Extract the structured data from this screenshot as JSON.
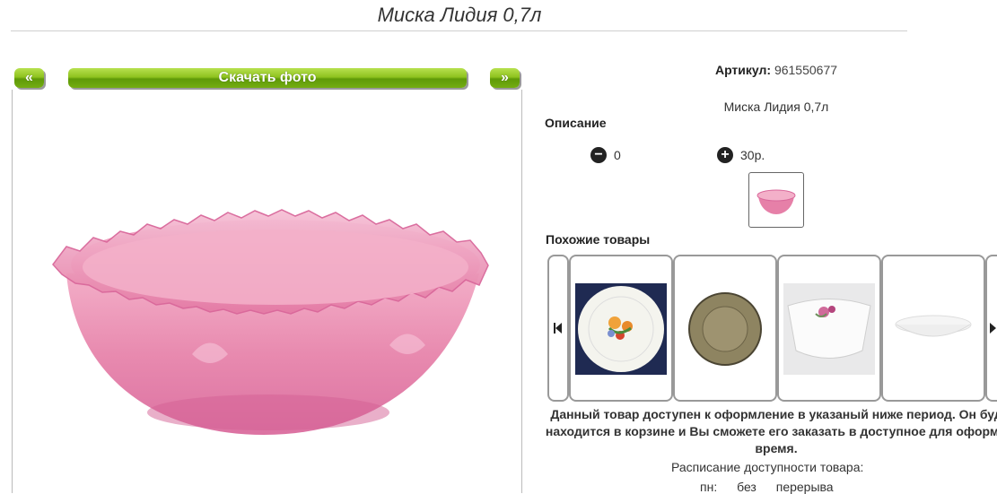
{
  "page": {
    "title": "Миска Лидия 0,7л"
  },
  "gallery": {
    "prev_label": "«",
    "download_label": "Скачать фото",
    "next_label": "»"
  },
  "product": {
    "sku_label": "Артикул:",
    "sku_value": "961550677",
    "name": "Миска Лидия 0,7л",
    "description_heading": "Описание",
    "qty_minus_value": "0",
    "qty_plus_value": "30р."
  },
  "similar": {
    "heading": "Похожие товары",
    "items": [
      {
        "image": "plate-with-flowers"
      },
      {
        "image": "amber-glass-plate"
      },
      {
        "image": "white-square-bowl-with-rose"
      },
      {
        "image": "white-shallow-dish"
      }
    ]
  },
  "availability": {
    "line1": "Данный товар доступен к оформление в указаный ниже период. Он буд",
    "line2": "находится в корзине и Вы сможете его заказать в доступное для оформл",
    "line3": "время.",
    "schedule_label": "Расписание доступности товара:",
    "schedule_row": "пн: без перерыва"
  },
  "colors": {
    "accent_green": "#7db61b",
    "product_pink": "#e77fa7"
  }
}
